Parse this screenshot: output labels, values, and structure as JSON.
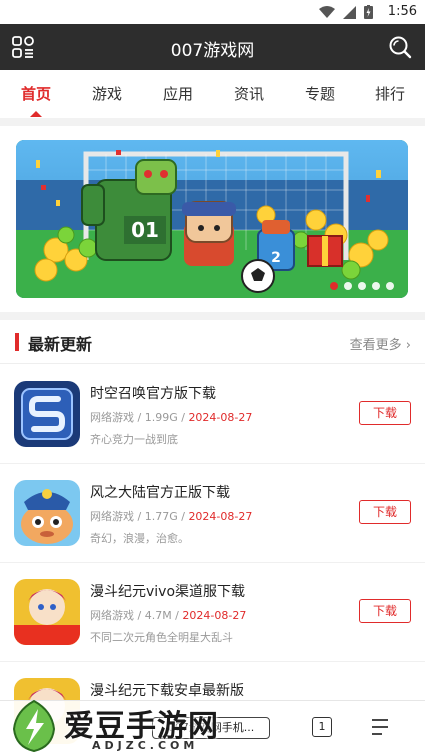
{
  "status_bar": {
    "time": "1:56"
  },
  "app_bar": {
    "title": "007游戏网"
  },
  "tabs": [
    {
      "label": "首页",
      "active": true
    },
    {
      "label": "游戏",
      "active": false
    },
    {
      "label": "应用",
      "active": false
    },
    {
      "label": "资讯",
      "active": false
    },
    {
      "label": "专题",
      "active": false
    },
    {
      "label": "排行",
      "active": false
    }
  ],
  "banner": {
    "slide_count": 5,
    "active_index": 0
  },
  "latest": {
    "title": "最新更新",
    "more": "查看更多",
    "items": [
      {
        "name": "时空召唤官方版下载",
        "category": "网络游戏",
        "size": "1.99G",
        "date": "2024-08-27",
        "desc": "齐心竞力一战到底",
        "button": "下载"
      },
      {
        "name": "风之大陆官方正版下载",
        "category": "网络游戏",
        "size": "1.77G",
        "date": "2024-08-27",
        "desc": "奇幻，浪漫，治愈。",
        "button": "下载"
      },
      {
        "name": "漫斗纪元vivo渠道服下载",
        "category": "网络游戏",
        "size": "4.7M",
        "date": "2024-08-27",
        "desc": "不同二次元角色全明星大乱斗",
        "button": "下载"
      },
      {
        "name": "漫斗纪元下载安卓最新版",
        "category": "",
        "size": "",
        "date": "",
        "desc": "",
        "button": ""
      }
    ]
  },
  "bottom_bar": {
    "url_text": "007游戏网手机...",
    "tab_count": "1"
  },
  "watermark": {
    "text": "爱豆手游网",
    "sub": "ADJZC.COM"
  },
  "colors": {
    "accent": "#e02b2b",
    "appbar": "#2d2d2d"
  }
}
